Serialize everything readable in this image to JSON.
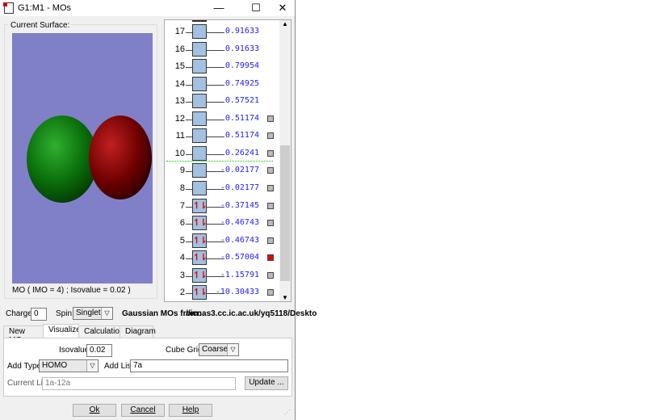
{
  "window": {
    "title": "G1:M1 - MOs",
    "minimize": "—",
    "maximize": "☐",
    "close": "✕"
  },
  "surface": {
    "group_label": "Current Surface:",
    "caption": "MO ( IMO = 4) ; Isovalue = 0.02 )",
    "background": "#8080c8",
    "lobe_colors": [
      "#0a7a0a",
      "#7a0000"
    ]
  },
  "orbitals": [
    {
      "n": "17",
      "energy": "0.91633",
      "occ": 0,
      "check": null
    },
    {
      "n": "16",
      "energy": "0.91633",
      "occ": 0,
      "check": null
    },
    {
      "n": "15",
      "energy": "0.79954",
      "occ": 0,
      "check": null
    },
    {
      "n": "14",
      "energy": "0.74925",
      "occ": 0,
      "check": null
    },
    {
      "n": "13",
      "energy": "0.57521",
      "occ": 0,
      "check": null
    },
    {
      "n": "12",
      "energy": "0.51174",
      "occ": 0,
      "check": "gray"
    },
    {
      "n": "11",
      "energy": "0.51174",
      "occ": 0,
      "check": "gray"
    },
    {
      "n": "10",
      "energy": "0.26241",
      "occ": 0,
      "check": "gray"
    },
    {
      "n": "9",
      "energy": "-0.02177",
      "occ": 0,
      "check": "gray"
    },
    {
      "n": "8",
      "energy": "-0.02177",
      "occ": 0,
      "check": "gray"
    },
    {
      "n": "7",
      "energy": "-0.37145",
      "occ": 2,
      "check": "gray"
    },
    {
      "n": "6",
      "energy": "-0.46743",
      "occ": 2,
      "check": "gray"
    },
    {
      "n": "5",
      "energy": "-0.46743",
      "occ": 2,
      "check": "gray"
    },
    {
      "n": "4",
      "energy": "-0.57004",
      "occ": 2,
      "check": "red"
    },
    {
      "n": "3",
      "energy": "-1.15791",
      "occ": 2,
      "check": "gray"
    },
    {
      "n": "2",
      "energy": "-10.30433",
      "occ": 2,
      "check": "gray"
    }
  ],
  "occ_glyph": "↿⇂",
  "controls": {
    "charge_label": "Charge:",
    "charge": "0",
    "spin_label": "Spin:",
    "spin": "Singlet",
    "source_label": "Gaussian MOs from:",
    "source": "//icnas3.cc.ic.ac.uk/yq5118/Deskto"
  },
  "tabs": [
    "New MOs",
    "Visualize",
    "Calculation",
    "Diagram"
  ],
  "visualize": {
    "isovalue_label": "Isovalue:",
    "isovalue": "0.02",
    "cube_grid_label": "Cube Grid:",
    "cube_grid": "Coarse",
    "add_type_label": "Add Type:",
    "add_type": "HOMO",
    "add_list_label": "Add List:",
    "add_list": "7a",
    "current_list_label": "Current List:",
    "current_list": "1a-12a",
    "update": "Update ..."
  },
  "buttons": {
    "ok": "Ok",
    "cancel": "Cancel",
    "help": "Help"
  }
}
